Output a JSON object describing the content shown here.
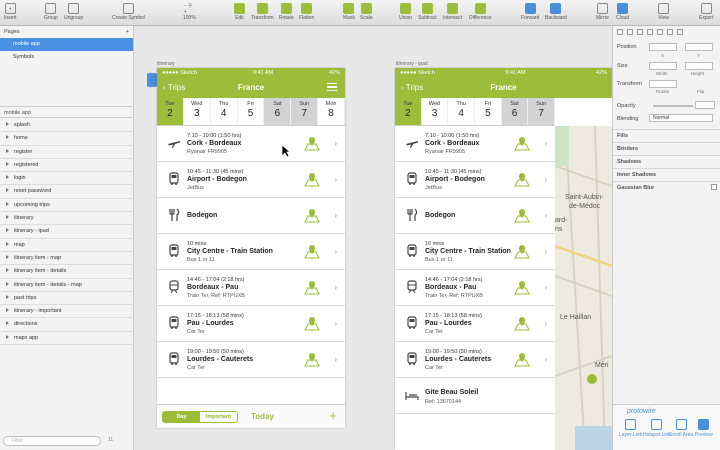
{
  "toolbar": {
    "insert": "Insert",
    "group": "Group",
    "ungroup": "Ungroup",
    "create_symbol": "Create Symbol",
    "zoom": "100%",
    "edit": "Edit",
    "transform": "Transform",
    "rotate": "Rotate",
    "flatten": "Flatten",
    "mask": "Mask",
    "scale": "Scale",
    "union": "Union",
    "subtract": "Subtract",
    "intersect": "Intersect",
    "difference": "Difference",
    "forward": "Forward",
    "backward": "Backward",
    "mirror": "Mirror",
    "cloud": "Cloud",
    "view": "View",
    "export": "Export"
  },
  "pages": {
    "header": "Pages",
    "items": [
      {
        "label": "mobile app",
        "selected": true
      },
      {
        "label": "Symbols",
        "selected": false
      }
    ]
  },
  "layers": {
    "header": "mobile app",
    "items": [
      "splash",
      "home",
      "register",
      "registered",
      "login",
      "reset password",
      "upcoming trips",
      "itinerary",
      "itinerary - ipad",
      "map",
      "itinerary item - map",
      "itinerary item - details",
      "itinerary item - details - map",
      "past trips",
      "itinerary - important",
      "directions",
      "maps app"
    ]
  },
  "filter": {
    "placeholder": "Filter",
    "count": "11"
  },
  "artboards": {
    "phone_label": "itinerary",
    "ipad_label": "itinerary - ipad"
  },
  "status": {
    "carrier": "●●●●● Sketch",
    "time": "9:41 AM",
    "battery": "42%"
  },
  "nav": {
    "back": "Trips",
    "title": "France"
  },
  "days": [
    {
      "dow": "Tue",
      "num": "2",
      "state": "sel"
    },
    {
      "dow": "Wed",
      "num": "3",
      "state": ""
    },
    {
      "dow": "Thu",
      "num": "4",
      "state": ""
    },
    {
      "dow": "Fri",
      "num": "5",
      "state": ""
    },
    {
      "dow": "Sat",
      "num": "6",
      "state": "we"
    },
    {
      "dow": "Sun",
      "num": "7",
      "state": "we"
    },
    {
      "dow": "Mon",
      "num": "8",
      "state": ""
    }
  ],
  "items": [
    {
      "icon": "plane",
      "time": "7:10 - 10:00 (1:50 hrs)",
      "title": "Cork - Bordeaux",
      "sub": "Ryanair FR9905"
    },
    {
      "icon": "bus",
      "time": "10:45 - 11:30 (45 mins)",
      "title": "Airport - Bodegon",
      "sub": "JetBus"
    },
    {
      "icon": "food",
      "time": "",
      "title": "Bodegon",
      "sub": ""
    },
    {
      "icon": "bus",
      "time": "10 mins",
      "title": "City Centre - Train Station",
      "sub": "Bus 1 or 11"
    },
    {
      "icon": "train",
      "time": "14:46 - 17:04 (2:18 hrs)",
      "title": "Bordeaux - Pau",
      "sub": "Train Ter, Ref: RTPUXB"
    },
    {
      "icon": "bus",
      "time": "17:15 - 18:13 (58 mins)",
      "title": "Pau - Lourdes",
      "sub": "Car Ter"
    },
    {
      "icon": "bus",
      "time": "19:00 - 19:50 (50 mins)",
      "title": "Lourdes - Cauterets",
      "sub": "Car Ter"
    }
  ],
  "ipad_extra": {
    "title": "Gite Beau Soleil",
    "sub": "Ref: 13670144"
  },
  "tabbar": {
    "day": "Day",
    "important": "Important",
    "today": "Today",
    "plus": "+"
  },
  "map": {
    "labels": [
      "Saint-Aubin-",
      "de-Médoc",
      "ard-",
      "ns",
      "Le Haillan",
      "Méri"
    ]
  },
  "inspector": {
    "position": "Position",
    "size": "Size",
    "transform": "Transform",
    "x": "X",
    "y": "Y",
    "width": "Width",
    "height": "Height",
    "rotate": "Rotate",
    "flip": "Flip",
    "opacity": "Opacity",
    "blending": "Blending",
    "blending_value": "Normal",
    "fills": "Fills",
    "borders": "Borders",
    "shadows": "Shadows",
    "inner_shadows": "Inner Shadows",
    "gaussian_blur": "Gaussian Blur"
  },
  "protowire": {
    "title": "protowire",
    "buttons": [
      "Layer Link",
      "Hotspot Link",
      "Scroll Area",
      "Preview"
    ]
  },
  "colors": {
    "accent": "#9bbd3a",
    "selection": "#4a90e2"
  }
}
